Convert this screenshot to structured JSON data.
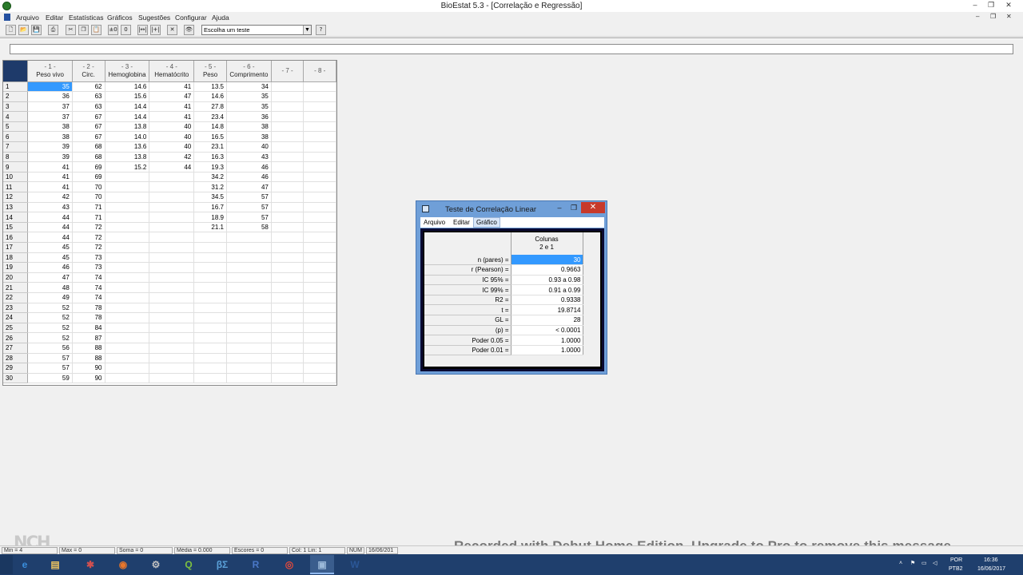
{
  "window": {
    "title": "BioEstat 5.3 - [Correlação e Regressão]",
    "minimize": "–",
    "restore": "❐",
    "close": "✕"
  },
  "menubar": {
    "items": [
      "Arquivo",
      "Editar",
      "Estatísticas",
      "Gráficos",
      "Sugestões",
      "Configurar",
      "Ajuda"
    ],
    "mdi_minimize": "–",
    "mdi_restore": "❐",
    "mdi_close": "✕"
  },
  "toolbar": {
    "test_select": "Escolha um teste",
    "buttons": [
      {
        "name": "new-file-icon",
        "glyph": "🗋"
      },
      {
        "name": "open-folder-icon",
        "glyph": "📂"
      },
      {
        "name": "save-icon",
        "glyph": "💾"
      },
      {
        "name": "print-icon",
        "glyph": "⎙"
      },
      {
        "name": "cut-icon",
        "glyph": "✂"
      },
      {
        "name": "copy-icon",
        "glyph": "❐"
      },
      {
        "name": "paste-icon",
        "glyph": "📋"
      },
      {
        "name": "decimal-icon",
        "glyph": "±0"
      },
      {
        "name": "decimal-increase-icon",
        "glyph": "0"
      },
      {
        "name": "insert-column-icon",
        "glyph": "|↔|"
      },
      {
        "name": "delete-column-icon",
        "glyph": "|+|"
      },
      {
        "name": "clear-icon",
        "glyph": "✕"
      },
      {
        "name": "binoculars-icon",
        "glyph": "👁"
      },
      {
        "name": "help-icon",
        "glyph": "?"
      }
    ]
  },
  "sheet": {
    "columns": [
      {
        "num": "- 1 -",
        "name": "Peso vivo"
      },
      {
        "num": "- 2 -",
        "name": "Circ."
      },
      {
        "num": "- 3 -",
        "name": "Hemoglobina"
      },
      {
        "num": "- 4 -",
        "name": "Hematócrito"
      },
      {
        "num": "- 5 -",
        "name": "Peso"
      },
      {
        "num": "- 6 -",
        "name": "Comprimento"
      },
      {
        "num": "- 7 -",
        "name": ""
      },
      {
        "num": "- 8 -",
        "name": ""
      }
    ],
    "rows": [
      [
        "1",
        "35",
        "62",
        "14.6",
        "41",
        "13.5",
        "34"
      ],
      [
        "2",
        "36",
        "63",
        "15.6",
        "47",
        "14.6",
        "35"
      ],
      [
        "3",
        "37",
        "63",
        "14.4",
        "41",
        "27.8",
        "35"
      ],
      [
        "4",
        "37",
        "67",
        "14.4",
        "41",
        "23.4",
        "36"
      ],
      [
        "5",
        "38",
        "67",
        "13.8",
        "40",
        "14.8",
        "38"
      ],
      [
        "6",
        "38",
        "67",
        "14.0",
        "40",
        "16.5",
        "38"
      ],
      [
        "7",
        "39",
        "68",
        "13.6",
        "40",
        "23.1",
        "40"
      ],
      [
        "8",
        "39",
        "68",
        "13.8",
        "42",
        "16.3",
        "43"
      ],
      [
        "9",
        "41",
        "69",
        "15.2",
        "44",
        "19.3",
        "46"
      ],
      [
        "10",
        "41",
        "69",
        "",
        "",
        "34.2",
        "46"
      ],
      [
        "11",
        "41",
        "70",
        "",
        "",
        "31.2",
        "47"
      ],
      [
        "12",
        "42",
        "70",
        "",
        "",
        "34.5",
        "57"
      ],
      [
        "13",
        "43",
        "71",
        "",
        "",
        "16.7",
        "57"
      ],
      [
        "14",
        "44",
        "71",
        "",
        "",
        "18.9",
        "57"
      ],
      [
        "15",
        "44",
        "72",
        "",
        "",
        "21.1",
        "58"
      ],
      [
        "16",
        "44",
        "72",
        "",
        "",
        "",
        ""
      ],
      [
        "17",
        "45",
        "72",
        "",
        "",
        "",
        ""
      ],
      [
        "18",
        "45",
        "73",
        "",
        "",
        "",
        ""
      ],
      [
        "19",
        "46",
        "73",
        "",
        "",
        "",
        ""
      ],
      [
        "20",
        "47",
        "74",
        "",
        "",
        "",
        ""
      ],
      [
        "21",
        "48",
        "74",
        "",
        "",
        "",
        ""
      ],
      [
        "22",
        "49",
        "74",
        "",
        "",
        "",
        ""
      ],
      [
        "23",
        "52",
        "78",
        "",
        "",
        "",
        ""
      ],
      [
        "24",
        "52",
        "78",
        "",
        "",
        "",
        ""
      ],
      [
        "25",
        "52",
        "84",
        "",
        "",
        "",
        ""
      ],
      [
        "26",
        "52",
        "87",
        "",
        "",
        "",
        ""
      ],
      [
        "27",
        "56",
        "88",
        "",
        "",
        "",
        ""
      ],
      [
        "28",
        "57",
        "88",
        "",
        "",
        "",
        ""
      ],
      [
        "29",
        "57",
        "90",
        "",
        "",
        "",
        ""
      ],
      [
        "30",
        "59",
        "90",
        "",
        "",
        "",
        ""
      ]
    ]
  },
  "dialog": {
    "title": "Teste de Correlação Linear",
    "menu": [
      "Arquivo",
      "Editar",
      "Gráfico"
    ],
    "header_line1": "Colunas",
    "header_line2": "2 e  1",
    "results": [
      {
        "label": "n (pares) =",
        "value": "30"
      },
      {
        "label": "r (Pearson) =",
        "value": "0.9663"
      },
      {
        "label": "IC 95% =",
        "value": "0.93 a 0.98"
      },
      {
        "label": "IC 99% =",
        "value": "0.91 a 0.99"
      },
      {
        "label": "R2 =",
        "value": "0.9338"
      },
      {
        "label": "t =",
        "value": "19.8714"
      },
      {
        "label": "GL =",
        "value": "28"
      },
      {
        "label": "(p) =",
        "value": "< 0.0001"
      },
      {
        "label": "Poder 0.05 =",
        "value": "1.0000"
      },
      {
        "label": "Poder 0.01 =",
        "value": "1.0000"
      }
    ]
  },
  "statusbar": {
    "min": "Min =  4",
    "max": "Max = 0",
    "soma": "Soma = 0",
    "media": "Média = 0.000",
    "escores": "Escores = 0",
    "col": "Col: 1  Lin: 1",
    "num": "NUM",
    "date": "16/06/201"
  },
  "watermark": "Recorded with Debut Home Edition. Upgrade to Pro to remove this message",
  "logo": "NCH",
  "taskbar": {
    "apps": [
      {
        "name": "ie-icon",
        "glyph": "e",
        "color": "#3a8fde"
      },
      {
        "name": "file-explorer-icon",
        "glyph": "▤",
        "color": "#e8c060"
      },
      {
        "name": "paint-icon",
        "glyph": "✱",
        "color": "#d05050"
      },
      {
        "name": "firefox-icon",
        "glyph": "◉",
        "color": "#e8762a"
      },
      {
        "name": "app-icon",
        "glyph": "⚙",
        "color": "#c0c0c0"
      },
      {
        "name": "qgis-icon",
        "glyph": "Q",
        "color": "#7cc040"
      },
      {
        "name": "bioestat-sigma-icon",
        "glyph": "βΣ",
        "color": "#5aa0d8"
      },
      {
        "name": "r-icon",
        "glyph": "R",
        "color": "#4a78c8"
      },
      {
        "name": "chrome-icon",
        "glyph": "◎",
        "color": "#e84a3a"
      },
      {
        "name": "bioestat-icon",
        "glyph": "▣",
        "color": "#9ab8d8"
      },
      {
        "name": "word-icon",
        "glyph": "W",
        "color": "#2b5797"
      }
    ],
    "lang1": "POR",
    "lang2": "PTB2",
    "time": "16:36",
    "date": "16/06/2017"
  }
}
